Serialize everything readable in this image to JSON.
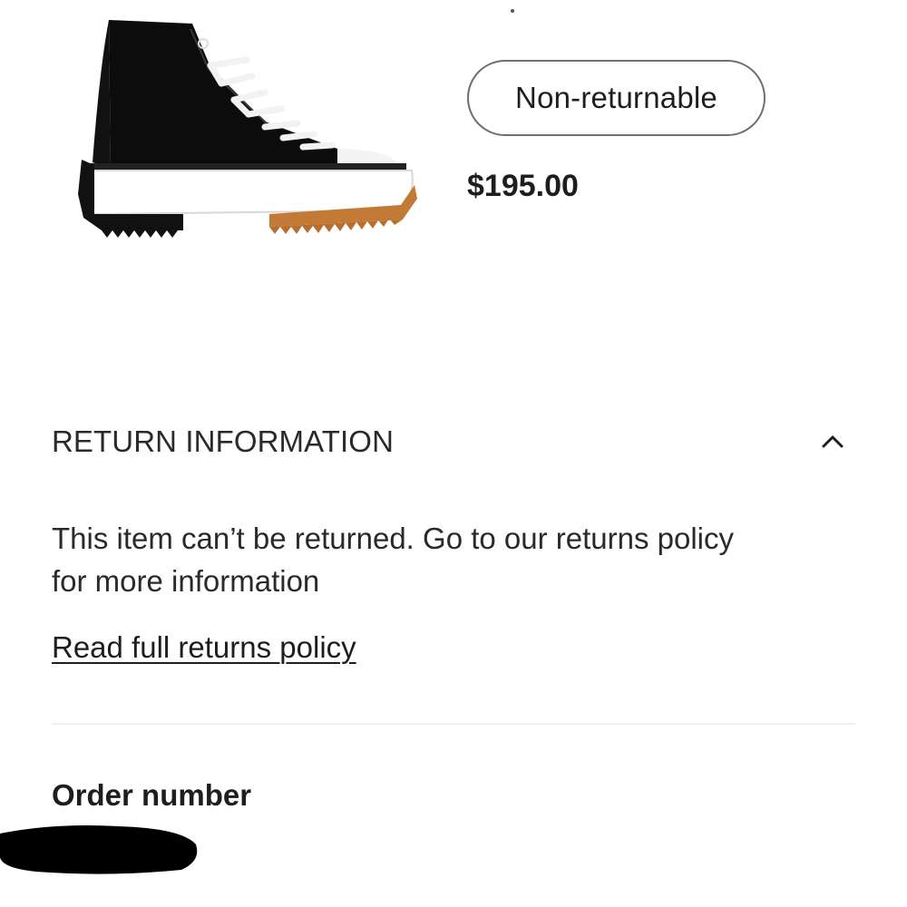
{
  "product": {
    "image_alt": "black high-top platform sneaker",
    "badge_label": "Non-returnable",
    "price": "$195.00"
  },
  "return_info": {
    "section_title": "RETURN INFORMATION",
    "expanded": true,
    "toggle_icon": "chevron-up-icon",
    "message_line1": "This item can’t be returned. Go to our returns policy",
    "message_line2": "for more information",
    "policy_link_label": "Read full returns policy"
  },
  "order": {
    "label": "Order number",
    "value_redacted": true
  },
  "colors": {
    "text": "#1e1e1e",
    "badge_border": "#6f6f6f",
    "divider": "#efefef",
    "redaction": "#000000"
  }
}
